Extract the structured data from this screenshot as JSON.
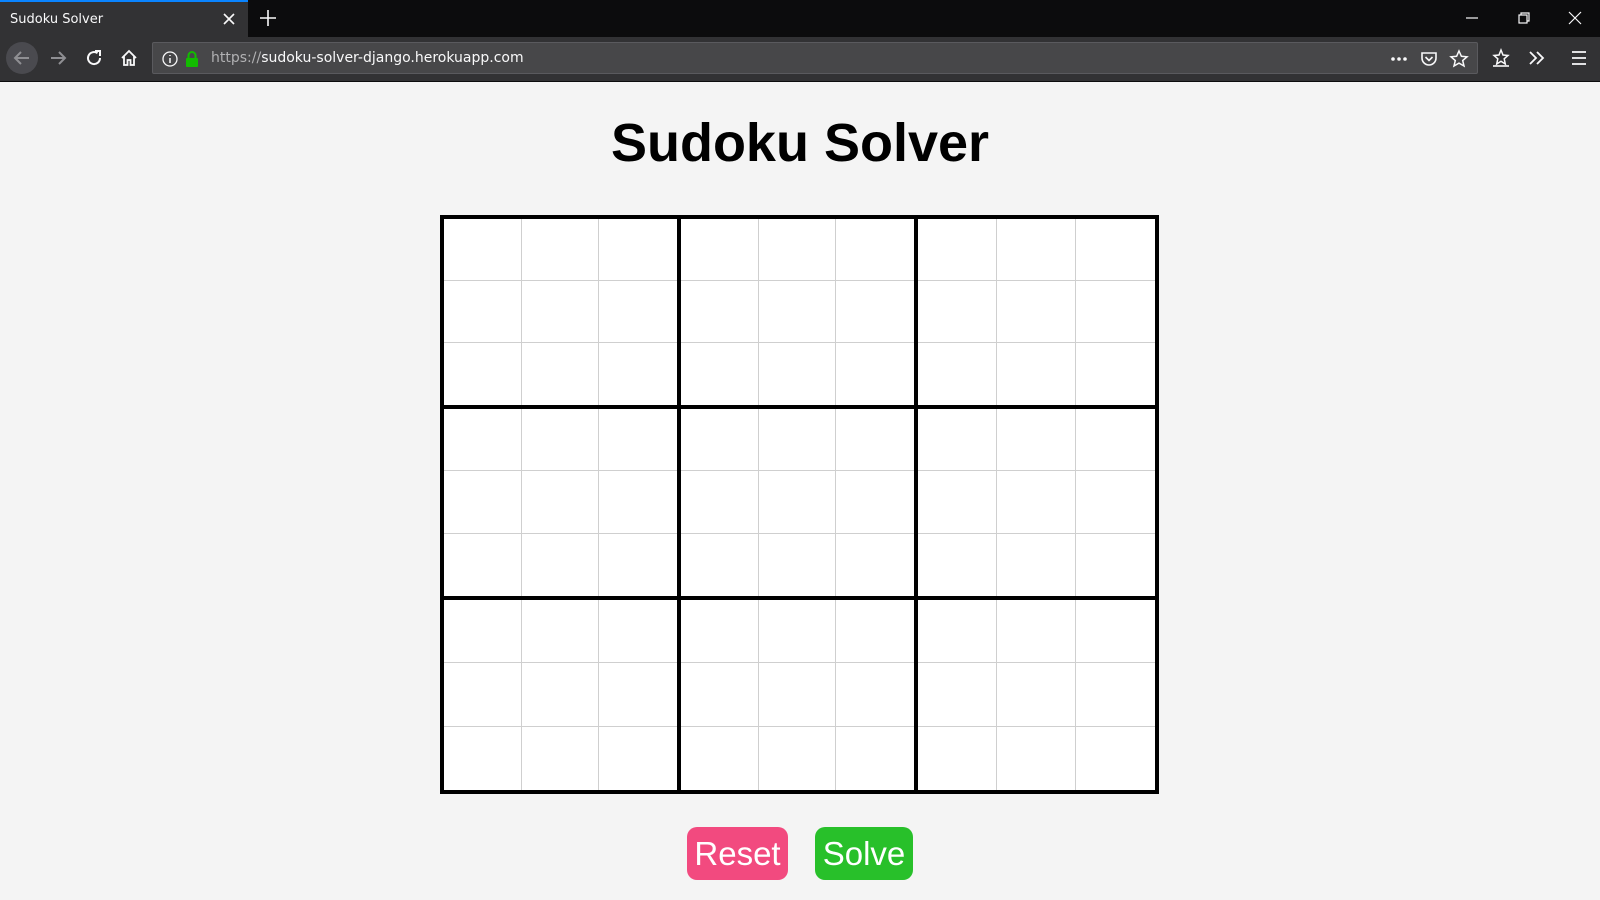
{
  "browser": {
    "tab": {
      "title": "Sudoku Solver"
    },
    "url": {
      "scheme": "https://",
      "host": "sudoku-solver-django.herokuapp.com"
    },
    "icons": {
      "tab_close": "close-icon",
      "new_tab": "plus-icon",
      "minimize": "minimize-icon",
      "restore": "restore-icon",
      "close_window": "close-icon",
      "back": "back-arrow-icon",
      "forward": "forward-arrow-icon",
      "reload": "reload-icon",
      "home": "home-icon",
      "info": "info-icon",
      "lock": "lock-icon",
      "page_actions": "more-icon",
      "pocket": "pocket-icon",
      "bookmark": "star-icon",
      "library": "library-icon",
      "overflow": "chevron-double-right-icon",
      "menu": "hamburger-menu-icon"
    }
  },
  "page": {
    "title": "Sudoku Solver",
    "grid_size": 9,
    "cells": [
      [
        "",
        "",
        "",
        "",
        "",
        "",
        "",
        "",
        ""
      ],
      [
        "",
        "",
        "",
        "",
        "",
        "",
        "",
        "",
        ""
      ],
      [
        "",
        "",
        "",
        "",
        "",
        "",
        "",
        "",
        ""
      ],
      [
        "",
        "",
        "",
        "",
        "",
        "",
        "",
        "",
        ""
      ],
      [
        "",
        "",
        "",
        "",
        "",
        "",
        "",
        "",
        ""
      ],
      [
        "",
        "",
        "",
        "",
        "",
        "",
        "",
        "",
        ""
      ],
      [
        "",
        "",
        "",
        "",
        "",
        "",
        "",
        "",
        ""
      ],
      [
        "",
        "",
        "",
        "",
        "",
        "",
        "",
        "",
        ""
      ],
      [
        "",
        "",
        "",
        "",
        "",
        "",
        "",
        "",
        ""
      ]
    ],
    "buttons": {
      "reset_label": "Reset",
      "solve_label": "Solve"
    }
  },
  "colors": {
    "reset_button": "#f24a7f",
    "solve_button": "#28c02a",
    "lock_icon": "#12bc00",
    "tab_accent": "#0a84ff"
  }
}
